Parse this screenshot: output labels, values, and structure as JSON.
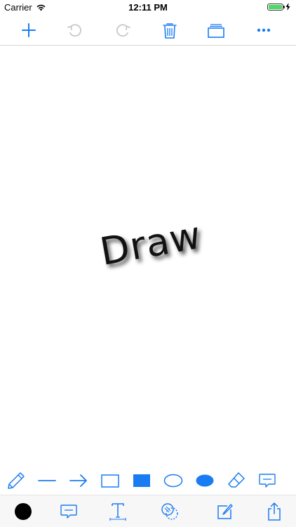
{
  "status_bar": {
    "carrier": "Carrier",
    "time": "12:11 PM"
  },
  "top_toolbar": {
    "buttons": [
      "add-icon",
      "undo-icon",
      "redo-icon",
      "trash-icon",
      "layers-icon",
      "more-icon"
    ]
  },
  "canvas": {
    "text": "Draw"
  },
  "shape_tools": [
    "pencil-icon",
    "line-icon",
    "arrow-icon",
    "rectangle-outline-icon",
    "rectangle-filled-icon",
    "ellipse-outline-icon",
    "ellipse-filled-icon",
    "eraser-icon",
    "speech-bubble-icon"
  ],
  "bottom_bar": {
    "buttons": [
      "color-swatch",
      "comment-icon",
      "text-tool-icon",
      "blend-icon",
      "edit-icon",
      "share-icon"
    ]
  },
  "colors": {
    "accent": "#1a7cf2",
    "disabled": "#c7c7cc",
    "current_color": "#000000",
    "battery": "#4cd964"
  }
}
